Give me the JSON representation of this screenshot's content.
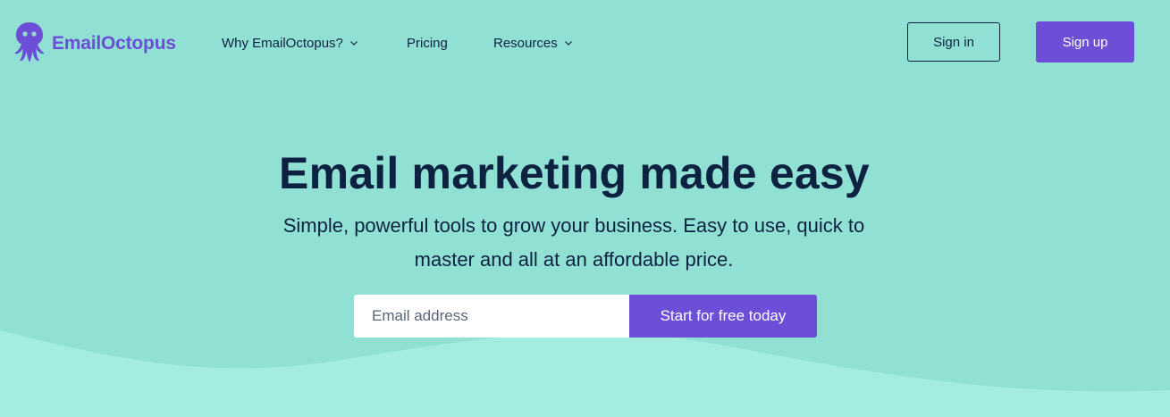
{
  "brand": {
    "name": "EmailOctopus",
    "logo_icon": "octopus-icon",
    "color": "#6c4fd6"
  },
  "nav": {
    "items": [
      {
        "label": "Why EmailOctopus?",
        "has_dropdown": true
      },
      {
        "label": "Pricing",
        "has_dropdown": false
      },
      {
        "label": "Resources",
        "has_dropdown": true
      }
    ],
    "sign_in": "Sign in",
    "sign_up": "Sign up"
  },
  "hero": {
    "title": "Email marketing made easy",
    "subtitle": "Simple, powerful tools to grow your business. Easy to use, quick to master and all at an affordable price.",
    "email_placeholder": "Email address",
    "email_value": "",
    "cta": "Start for free today"
  },
  "colors": {
    "background": "#91e0d4",
    "wave": "#a2ece0",
    "text": "#0d2240",
    "accent": "#6c4fd6"
  }
}
